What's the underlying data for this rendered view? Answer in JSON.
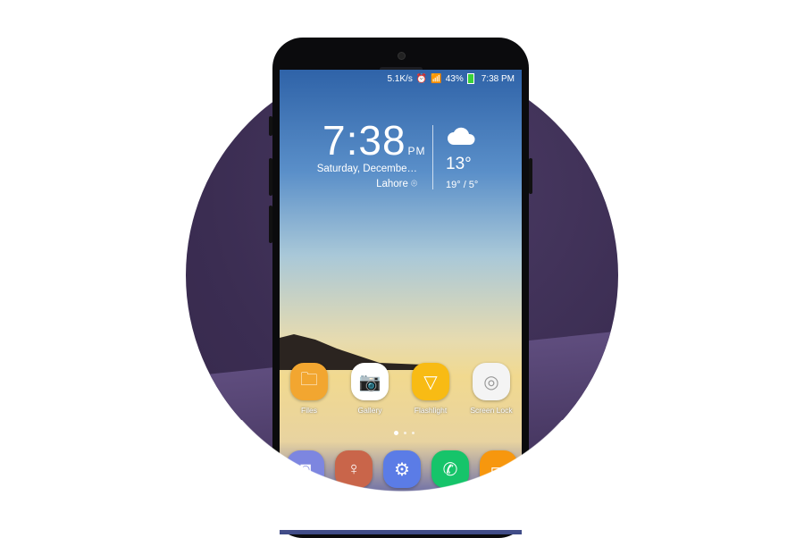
{
  "status_bar": {
    "speed": "5.1K/s",
    "battery": "43%",
    "time": "7:38 PM"
  },
  "clock_widget": {
    "time": "7:38",
    "ampm": "PM",
    "date": "Saturday, Decembe…",
    "city": "Lahore",
    "temperature": "13°",
    "range": "19° / 5°",
    "weather_icon": "cloud-icon"
  },
  "apps": [
    {
      "label": "Files",
      "color": "#f2a630"
    },
    {
      "label": "Gallery",
      "color": "#ffffff"
    },
    {
      "label": "Flashlight",
      "color": "#f8bb14"
    },
    {
      "label": "Screen Lock",
      "color": "#f4f4f4"
    }
  ],
  "dock": [
    {
      "name": "camera",
      "color": "#7d86e0"
    },
    {
      "name": "contacts",
      "color": "#c9654a"
    },
    {
      "name": "settings",
      "color": "#5b7ce6"
    },
    {
      "name": "phone",
      "color": "#16c46a"
    },
    {
      "name": "messages",
      "color": "#f7970e"
    }
  ],
  "background": {
    "circle": "#3b2d52"
  }
}
